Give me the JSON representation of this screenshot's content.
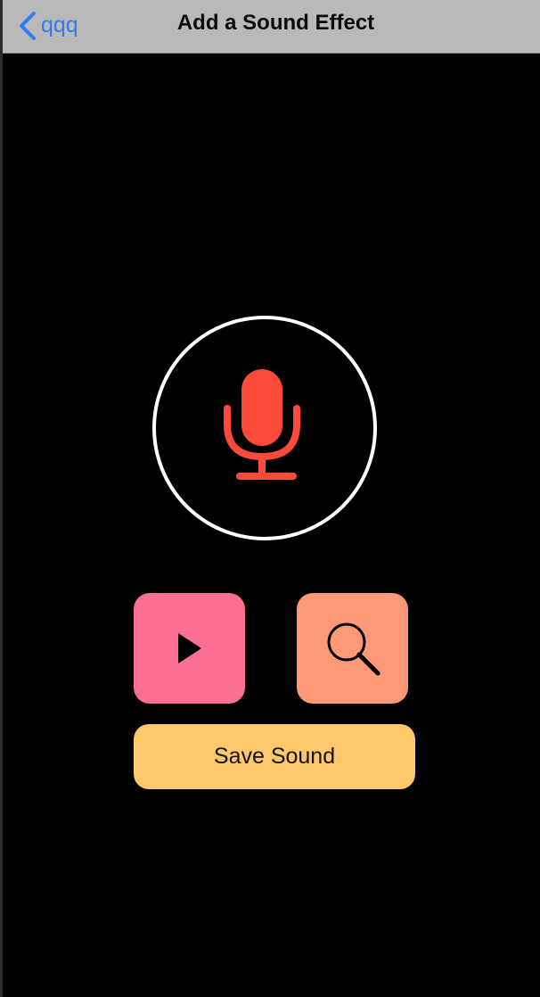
{
  "nav": {
    "back_label": "qqq",
    "back_icon": "chevron-left-icon",
    "title": "Add a Sound Effect"
  },
  "record": {
    "icon": "microphone-icon"
  },
  "controls": {
    "play_icon": "play-icon",
    "search_icon": "search-icon",
    "save_label": "Save Sound"
  },
  "colors": {
    "background": "#000000",
    "nav_bar": "#b9b9b9",
    "back_link": "#2f7cf6",
    "mic": "#fe4a3b",
    "play_button": "#fd7094",
    "search_button": "#fe9877",
    "save_button": "#fec76b"
  }
}
